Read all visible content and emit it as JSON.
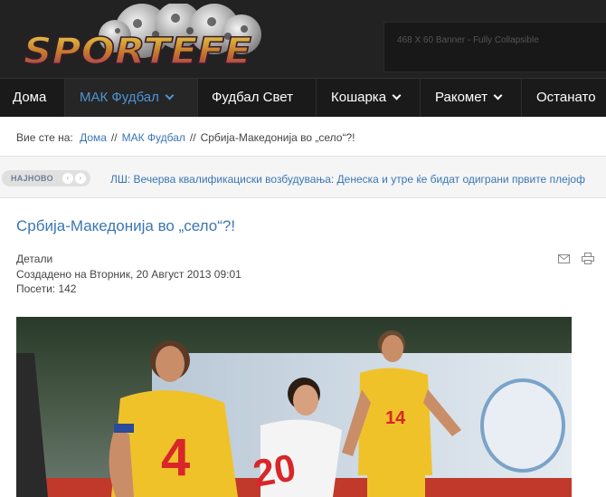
{
  "site": {
    "logo_text": "SPORTEFE",
    "banner_text": "468 X 60 Banner - Fully Collapsible"
  },
  "nav": {
    "items": [
      {
        "label": "Дома",
        "dropdown": false,
        "active": false
      },
      {
        "label": "МАК Фудбал",
        "dropdown": true,
        "active": true
      },
      {
        "label": "Фудбал Свет",
        "dropdown": false,
        "active": false
      },
      {
        "label": "Кошарка",
        "dropdown": true,
        "active": false
      },
      {
        "label": "Ракомет",
        "dropdown": true,
        "active": false
      },
      {
        "label": "Останато",
        "dropdown": false,
        "active": false
      }
    ]
  },
  "breadcrumb": {
    "prefix": "Вие сте на:",
    "links": [
      "Дома",
      "МАК Фудбал"
    ],
    "separator": "//",
    "current": "Србија-Македонија во „село“?!"
  },
  "ticker": {
    "badge": "НАЈНОВО",
    "prev": "‹",
    "next": "›",
    "text": "ЛШ: Вечерва квалификациски возбудувања: Денеска и утре ќе бидат одиграни првите плејоф"
  },
  "article": {
    "title": "Србија-Македонија во „село“?!",
    "details_label": "Детали",
    "created": "Создадено на Вторник, 20 Август 2013 09:01",
    "hits": "Посети: 142",
    "photo": {
      "players": [
        {
          "number": "4",
          "shirt_color": "#f0c22a",
          "number_color": "#d8262a"
        },
        {
          "number": "20",
          "shirt_color": "#ffffff",
          "number_color": "#d8262a"
        },
        {
          "number": "14",
          "shirt_color": "#f0c22a",
          "number_color": "#d8262a"
        }
      ]
    }
  },
  "colors": {
    "accent": "#3a76b5",
    "nav_bg": "#1a1a1a",
    "header_bg": "#222222"
  }
}
